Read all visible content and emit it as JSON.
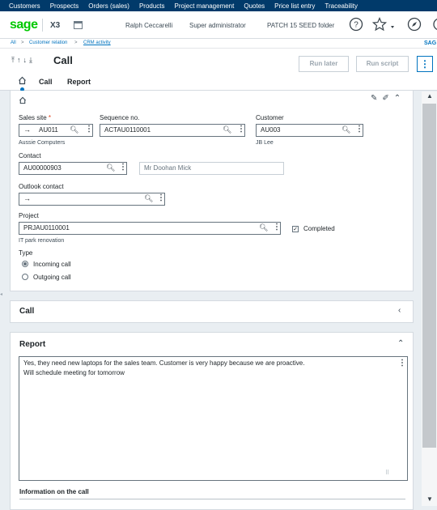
{
  "topnav": {
    "items": [
      "Customers",
      "Prospects",
      "Orders (sales)",
      "Products",
      "Project management",
      "Quotes",
      "Price list entry",
      "Traceability"
    ]
  },
  "header": {
    "logo": "sage",
    "product": "X3",
    "user": "Ralph Ceccarelli",
    "role": "Super administrator",
    "folder": "PATCH 15 SEED folder",
    "overflow_text": "SAG"
  },
  "breadcrumb": {
    "all": "All",
    "customer_relation": "Customer relation",
    "crm_activity": "CRM activity",
    "overflow": "SAG"
  },
  "toolbar": {
    "title": "Call",
    "run_later": "Run later",
    "run_script": "Run script"
  },
  "tabs": [
    "Call",
    "Report"
  ],
  "form": {
    "sales_site": {
      "label": "Sales site",
      "required": "*",
      "value": "AU011",
      "description": "Aussie Computers"
    },
    "sequence": {
      "label": "Sequence no.",
      "value": "ACTAU0110001"
    },
    "customer": {
      "label": "Customer",
      "value": "AU003",
      "description": "JB Lee"
    },
    "contact": {
      "label": "Contact",
      "value": "AU00000903",
      "name": "Mr Doohan Mick"
    },
    "outlook_contact": {
      "label": "Outlook contact",
      "value": ""
    },
    "project": {
      "label": "Project",
      "value": "PRJAU0110001",
      "description": "IT park renovation"
    },
    "completed": {
      "label": "Completed",
      "checked": true
    },
    "type": {
      "label": "Type",
      "options": [
        "Incoming call",
        "Outgoing call"
      ],
      "selected": "Incoming call"
    }
  },
  "sections": {
    "call": {
      "title": "Call"
    },
    "report": {
      "title": "Report",
      "lines": [
        "Yes, they need new laptops for the sales team. Customer is very happy because we are proactive.",
        "Will schedule meeting for tomorrow"
      ],
      "info_title": "Information on the call"
    }
  },
  "icons": {
    "home": "home-icon",
    "search": "magnifier-icon",
    "more": "vertical-dots-icon",
    "help": "help-icon",
    "star": "star-icon",
    "compass": "compass-icon",
    "calendar": "calendar-icon"
  },
  "colors": {
    "topnav_bg": "#013a6a",
    "accent": "#0073bf",
    "sage_green": "#00c800"
  }
}
